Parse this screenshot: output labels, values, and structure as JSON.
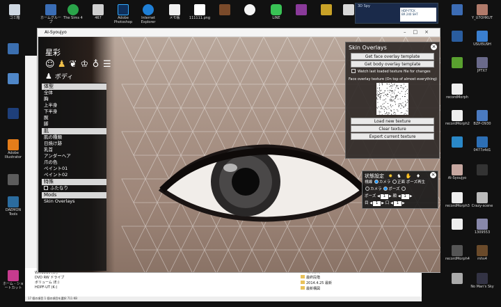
{
  "desktop": {
    "icons_left": [
      "ゴミ箱",
      "ホーム - ショートカット",
      "Windows 7",
      "DAEMON Tools",
      "Adobe Illustrator",
      "アクセス"
    ],
    "icons_top": [
      "ゴミ箱",
      "ホームグループ",
      "The Sims 4",
      "467",
      "Adobe Photoshop",
      "Internet Explorer",
      "メモ帳",
      "111111.png",
      "ジグソー",
      "KX",
      "LINE",
      "アプリ",
      "無料ソフト",
      "ドキュメント"
    ],
    "icons_right": [
      "Y_U7OHKUT",
      "USUI5U9H",
      "アプリ2",
      "JPTX7",
      "画像",
      "recordMorph",
      "BZP-O930",
      "recordMorph2",
      "0477z4d1",
      "AI-Syoujyo",
      "recordMorph3",
      "Crazy-scene",
      "1309553",
      "recordMorph4",
      "mhs4",
      "NorrisDenmark",
      "No Man's Sky"
    ]
  },
  "taskwin": {
    "title": "3D Spy",
    "line1": "HDP-FTCK",
    "line2": "BR 240 SHT"
  },
  "explorer": {
    "side_items": [
      "Windows (C:)",
      "DVD RW ドライブ",
      "ボリューム (E:)",
      "HDPF-UT (K:)"
    ],
    "files": [
      "現代彫刻",
      "最終段階",
      "2014.4.25 最新",
      "最新構図"
    ],
    "status": "17 個の項目  1 個の項目を選択 711 KB"
  },
  "window": {
    "title": "AI-Syoujyo"
  },
  "menu": {
    "brand": "星彩",
    "tab_icons": [
      "face-icon",
      "body-icon",
      "hair-icon",
      "clothes-icon",
      "accessory-icon",
      "list-icon"
    ],
    "tab_body_label": "ボディ",
    "sections": [
      {
        "title": "体型",
        "items": [
          "全体",
          "胸",
          "上半身",
          "下半身",
          "腕",
          "脚"
        ]
      },
      {
        "title": "肌",
        "items": [
          "肌の種類",
          "日焼け跡",
          "乳首",
          "アンダーヘア",
          "爪の色",
          "ペイント01",
          "ペイント02"
        ]
      },
      {
        "title": "特殊",
        "items": [
          "ふたなり"
        ]
      },
      {
        "title": "Mods",
        "items": [
          "Skin Overlays"
        ]
      }
    ]
  },
  "skin_overlays": {
    "title": "Skin Overlays",
    "get_face": "Get face overlay template",
    "get_body": "Get body overlay template",
    "watch_label": "Watch last loaded texture file for changes",
    "face_label": "Face overlay texture (On top of almost everything)",
    "load_new": "Load new texture",
    "clear": "Clear texture",
    "export": "Export current texture"
  },
  "state_panel": {
    "title": "状態設定",
    "row1_label": "視線",
    "row1_opt1": "カメラ",
    "row1_opt2": "正面",
    "row1_opt3": "ポーズ再生",
    "row2_opt1": "カメラ",
    "row2_opt2": "ポーズ",
    "pose_label": "ポーズ",
    "pose_value": "1",
    "face_label": "顔",
    "face_value": "1",
    "eye_label": "目",
    "eye_value": "1",
    "mouth_label": "口",
    "mouth_value": "1"
  },
  "colors": {
    "panel_bg": "#2d2826",
    "accent": "#2299ff",
    "section_bg": "#d8d8d8"
  }
}
